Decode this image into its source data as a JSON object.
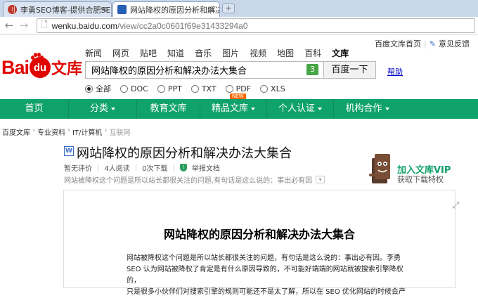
{
  "browser": {
    "tabs": [
      {
        "title": "李勇SEO博客-提供合肥SE...",
        "active": false
      },
      {
        "title": "网站降权的原因分析和解决...",
        "active": true
      }
    ],
    "new_tab": "+",
    "url_host": "wenku.baidu.com",
    "url_path": "/view/cc2a0c0601f69e31433294a0",
    "back_icon": "back-arrow-icon",
    "forward_icon": "forward-arrow-icon",
    "reload_icon": "reload-icon"
  },
  "header": {
    "top_links": [
      "百度文库首页",
      "意见反馈"
    ],
    "logo_text": {
      "bai": "Bai",
      "du": "du",
      "ku": "文库"
    },
    "categories": [
      "新闻",
      "网页",
      "贴吧",
      "知道",
      "音乐",
      "图片",
      "视频",
      "地图",
      "百科",
      "文库"
    ],
    "active_category": "文库",
    "search_value": "网站降权的原因分析和解决办法大集合",
    "search_badge": "3",
    "search_button": "百度一下",
    "help": "帮助",
    "filters": [
      "全部",
      "DOC",
      "PPT",
      "TXT",
      "PDF",
      "XLS"
    ],
    "selected_filter": "全部",
    "new_badge": "NEW"
  },
  "nav": {
    "items": [
      {
        "label": "首页",
        "dropdown": false
      },
      {
        "label": "分类",
        "dropdown": true
      },
      {
        "label": "教育文库",
        "dropdown": false
      },
      {
        "label": "精品文库",
        "dropdown": true
      },
      {
        "label": "个人认证",
        "dropdown": true
      },
      {
        "label": "机构合作",
        "dropdown": true
      }
    ],
    "color": "#10a26b"
  },
  "breadcrumb": [
    "百度文库",
    "专业资料",
    "IT/计算机",
    "互联网"
  ],
  "doc": {
    "icon": "W",
    "title": "网站降权的原因分析和解决办法大集合",
    "rating": "暂无评价",
    "readers": "4人阅读",
    "downloads": "0次下载",
    "report": "举报文档",
    "summary": "网站被降权这个问题是所以站长都很关注的问题,有句话是这么说的：事出必有因",
    "vip_title": "加入文库VIP",
    "vip_sub": "获取下载特权",
    "page_title": "网站降权的原因分析和解决办法大集合",
    "body_lines": [
      "网站被降权这个问题是所以站长都很关注的问题，有句话是这么说的：事出必有因。李勇",
      "SEO 认为网站被降权了肯定是有什么原因导致的，不可能好端端的网站就被搜索引擎降权的，",
      "只是很多小伙伴们对搜索引擎的规则可能还不是太了解，所以在 SEO 优化网站的时候会产"
    ]
  }
}
